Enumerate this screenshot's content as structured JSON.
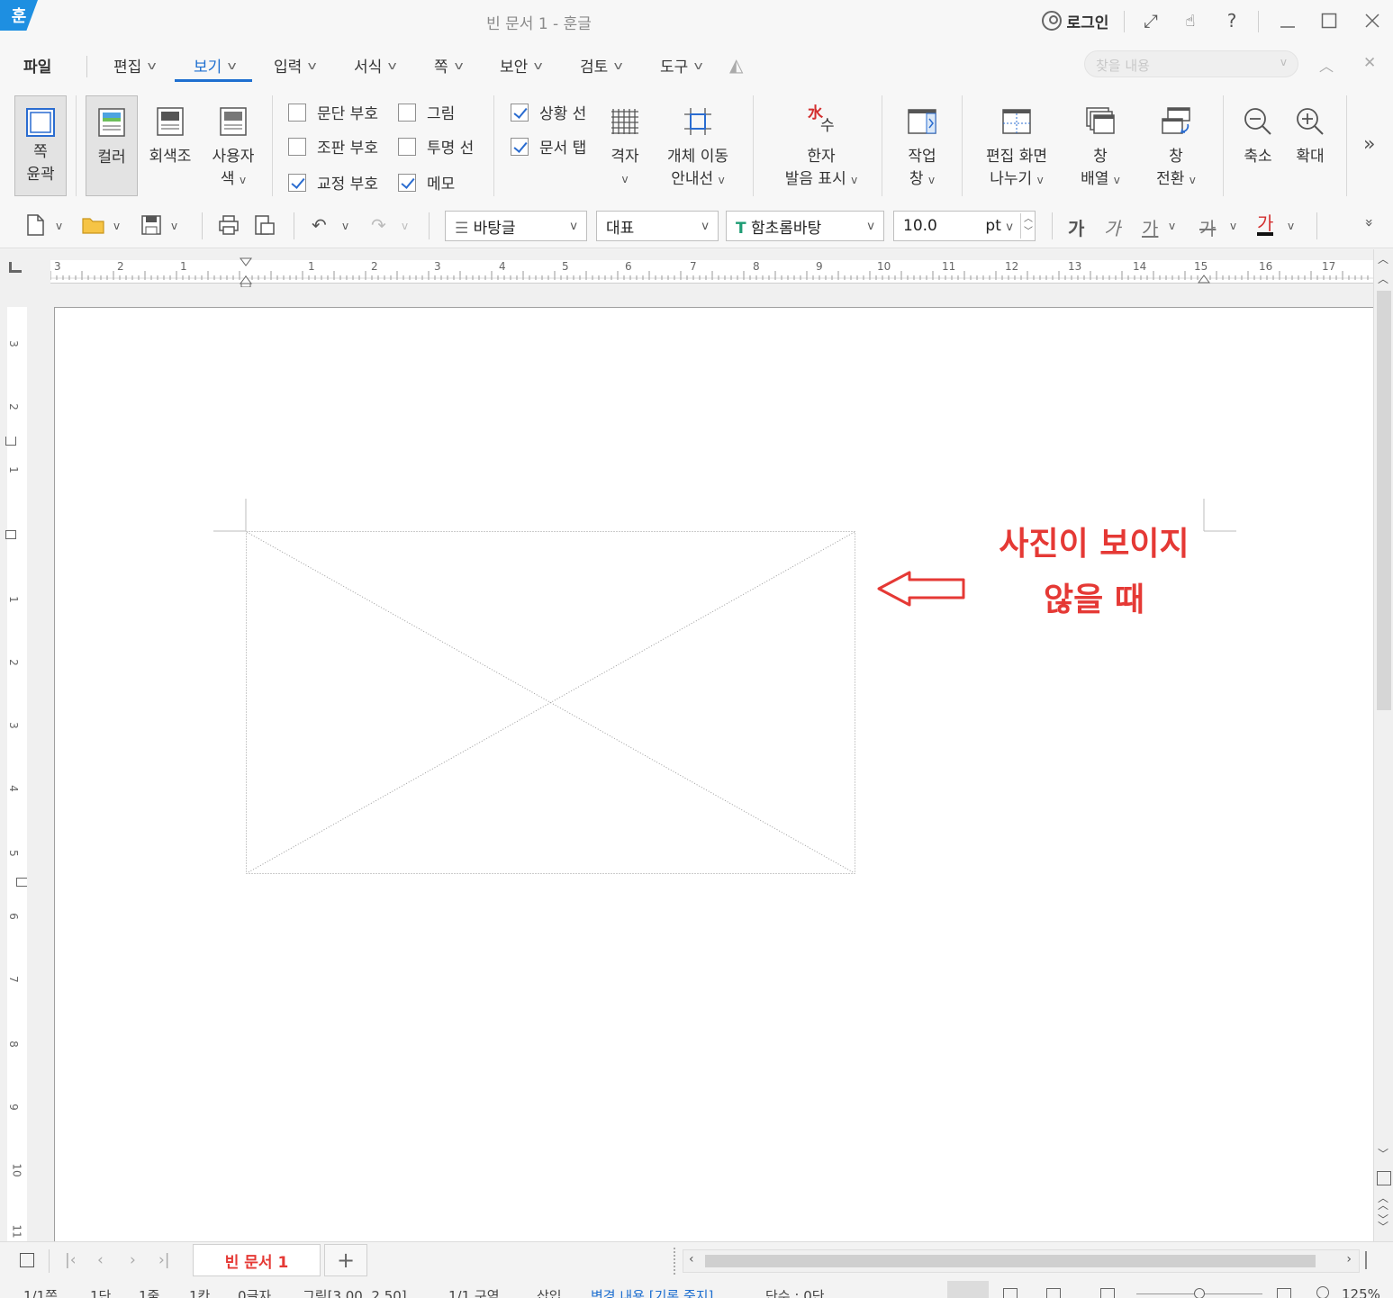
{
  "window": {
    "app_logo": "훈",
    "title": "빈 문서 1 - 훈글",
    "login_label": "로그인",
    "help_label": "?"
  },
  "menu": {
    "file": "파일",
    "tabs": [
      {
        "label": "편집"
      },
      {
        "label": "보기"
      },
      {
        "label": "입력"
      },
      {
        "label": "서식"
      },
      {
        "label": "쪽"
      },
      {
        "label": "보안"
      },
      {
        "label": "검토"
      },
      {
        "label": "도구"
      }
    ],
    "active_tab": "보기",
    "search_placeholder": "찾을 내용"
  },
  "ribbon": {
    "page_outline": [
      "쪽",
      "윤곽"
    ],
    "color": "컬러",
    "grayscale": "회색조",
    "user_color": [
      "사용자",
      "색"
    ],
    "checkboxes": [
      {
        "label": "문단 부호",
        "checked": false
      },
      {
        "label": "그림",
        "checked": false
      },
      {
        "label": "조판 부호",
        "checked": false
      },
      {
        "label": "투명 선",
        "checked": false
      },
      {
        "label": "교정 부호",
        "checked": true
      },
      {
        "label": "메모",
        "checked": true
      },
      {
        "label": "상황 선",
        "checked": true
      },
      {
        "label": "문서 탭",
        "checked": true
      }
    ],
    "grid": "격자",
    "object_guide": [
      "개체 이동",
      "안내선"
    ],
    "hanja_icon_top": "水",
    "hanja_icon_bottom": "수",
    "hanja": [
      "한자",
      "발음 표시"
    ],
    "task_pane": [
      "작업",
      "창"
    ],
    "split_view": [
      "편집 화면",
      "나누기"
    ],
    "arrange": [
      "창",
      "배열"
    ],
    "switch": [
      "창",
      "전환"
    ],
    "zoom_out": "축소",
    "zoom_in": "확대"
  },
  "format_bar": {
    "style": "바탕글",
    "lang": "대표",
    "font": "함초롬바탕",
    "size": "10.0",
    "unit": "pt",
    "bold_char": "가",
    "italic_char": "가",
    "underline_char": "가",
    "strike_char": "가",
    "color_char": "가"
  },
  "ruler": {
    "h_ticks": [
      "3",
      "2",
      "1",
      "1",
      "2",
      "3",
      "4",
      "5",
      "6",
      "7",
      "8",
      "9",
      "10",
      "11",
      "12",
      "13",
      "14",
      "15",
      "16",
      "17"
    ],
    "v_ticks": [
      "3",
      "2",
      "1",
      "1",
      "2",
      "3",
      "4",
      "5",
      "6",
      "7",
      "8",
      "9",
      "10",
      "11"
    ]
  },
  "annotation": {
    "line1": "사진이 보이지",
    "line2": "않을 때",
    "color": "#e53935"
  },
  "tabs": {
    "doc_tab": "빈 문서 1",
    "add_label": "+"
  },
  "status": {
    "page": "1/1쪽",
    "column": "1단",
    "line": "1줄",
    "char": "1칸",
    "chars": "0글자",
    "object": "그림[3.00, 2.50]",
    "section": "1/1 구역",
    "mode": "삽입",
    "track": "변경 내용 [기록 중지]",
    "words": "단수 : 0단",
    "zoom": "125%"
  },
  "colors": {
    "accent": "#1e6fd0",
    "logo": "#1e8fe1",
    "annotation": "#e53935"
  }
}
